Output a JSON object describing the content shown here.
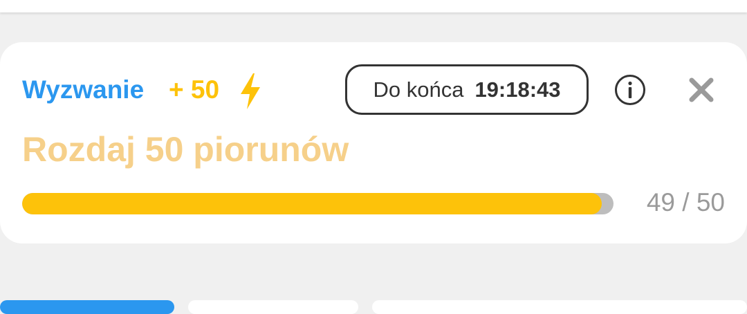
{
  "challenge": {
    "label": "Wyzwanie",
    "points": "+ 50",
    "points_icon": "lightning-bolt-icon",
    "timer_label": "Do końca",
    "timer_value": "19:18:43",
    "title": "Rozdaj 50 piorunów",
    "progress": {
      "current": "49",
      "separator": "/",
      "total": "50",
      "fraction": 0.98
    }
  },
  "icons": {
    "info": "info-icon",
    "close": "close-icon"
  },
  "colors": {
    "label_blue": "#2b97ef",
    "accent_yellow": "#fdc20a",
    "title_peach": "#f6d08a",
    "track_gray": "#bdbdbd",
    "text_dark": "#333333",
    "text_gray": "#9a9a9a",
    "background": "#f0f0f0",
    "tab_active": "#2b97ef"
  }
}
